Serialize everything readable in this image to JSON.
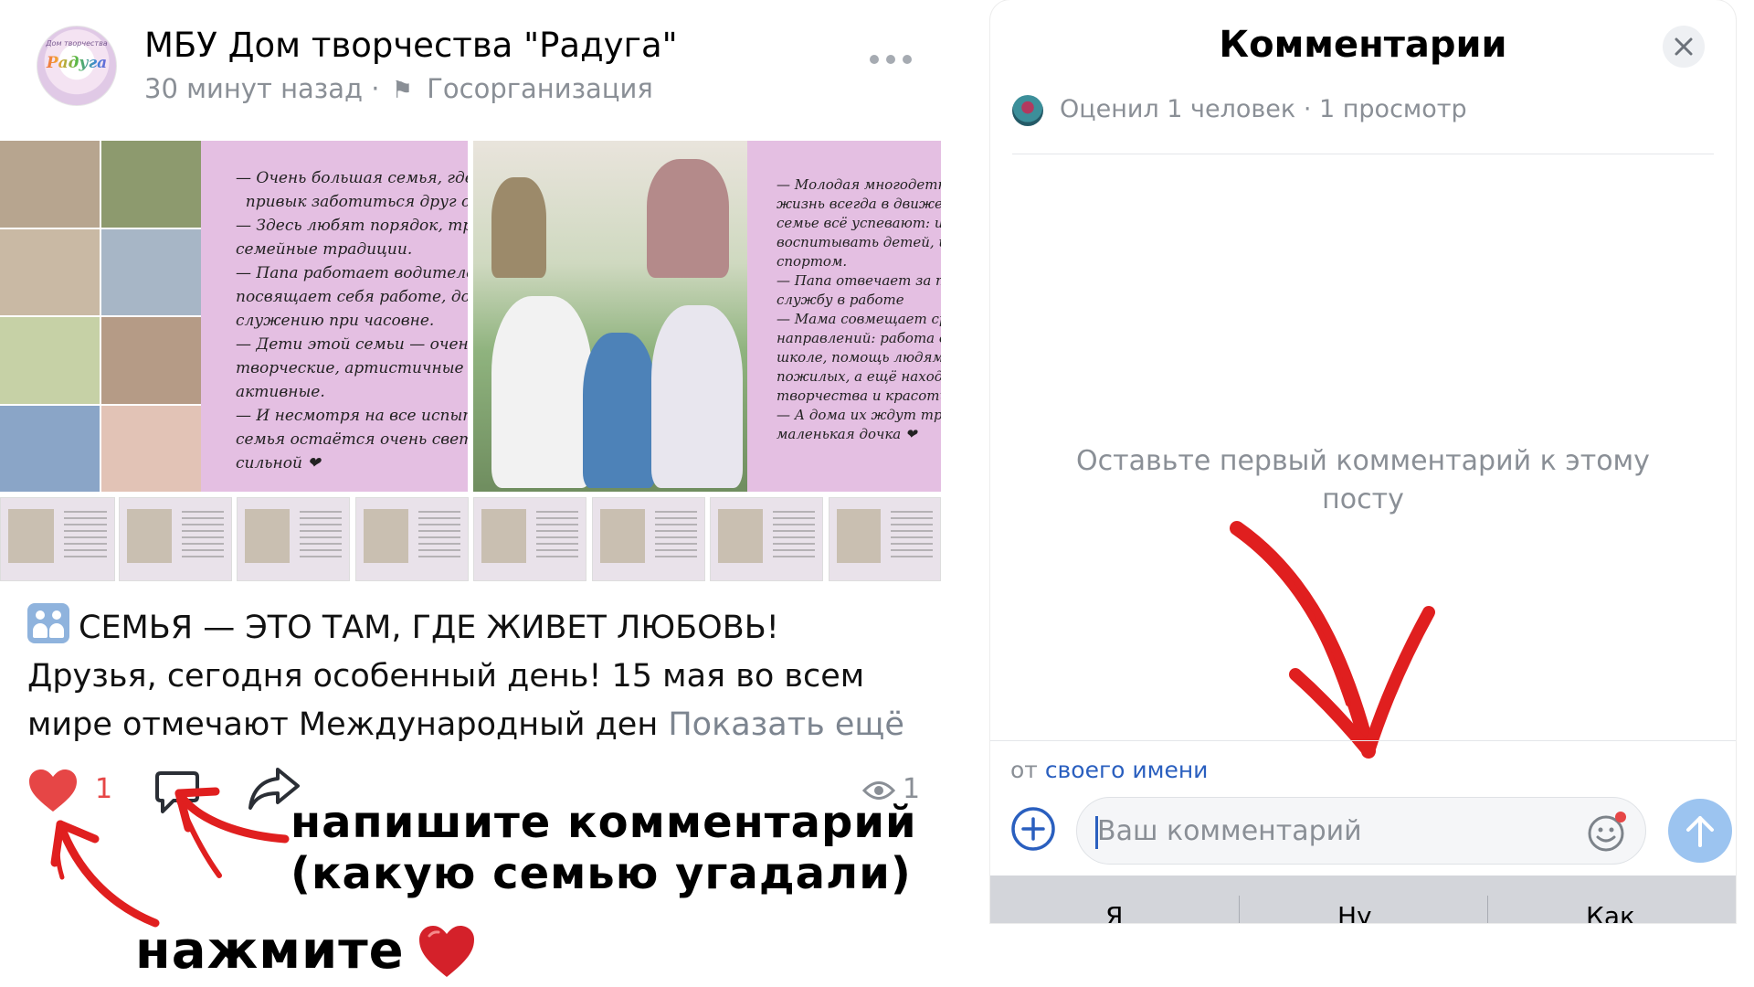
{
  "post": {
    "author": "МБУ Дом творчества \"Радуга\"",
    "time": "30 минут назад",
    "separator": "·",
    "org_type": "Госорганизация",
    "avatar_logo_top": "Дом творчества",
    "avatar_logo_word": "Радуга",
    "image1_text": "— Очень большая семья, где ка\n  привык заботиться друг о дру\n— Здесь любят порядок, труд\nсемейные традиции.\n— Папа работает водителем\nпосвящает себя работе, дому\nслужению при часовне.\n— Дети этой семьи — очень\nтворческие, артистичные и\nактивные.\n— И несмотря на все испытан\nсемья остаётся очень светлой\nсильной ❤",
    "image2_text": "— Молодая многодетная се\nжизнь всегда в движении. В\nсемье всё успевают: и рабо\nвоспитывать детей, и зан\nспортом.\n— Папа отвечает за техн\nслужбу в работе\n— Мама совмещает сразу\nнаправлений: работа с дет\nшколе, помощь людям и за\nпожилых, а ещё находит вр\nтворчества и красоты\n— А дома их ждут три сын\nмаленькая дочка ❤",
    "text_line1": "СЕМЬЯ — ЭТО ТАМ, ГДЕ ЖИВЕТ ЛЮБОВЬ!",
    "text_line2": "Друзья, сегодня особенный день! 15 мая во всем",
    "text_line3": "мире отмечают Международный ден",
    "show_more": "Показать ещё",
    "likes": "1",
    "views": "1"
  },
  "annotations": {
    "line1": "напишите комментарий",
    "line2": "(какую семью угадали)",
    "line3": "нажмите"
  },
  "comments": {
    "title": "Комментарии",
    "rated": "Оценил 1 человек",
    "views": "1 просмотр",
    "separator": "·",
    "empty": "Оставьте первый комментарий к этому посту",
    "from_prefix": "от",
    "from_link": "своего имени",
    "input_placeholder": "Ваш комментарий",
    "input_value": "",
    "keyboard_suggestions": [
      "Я",
      "Ну",
      "Как"
    ]
  },
  "colors": {
    "heart": "#e64646",
    "annotation_arrow": "#e01f1f",
    "link": "#2a5fbf",
    "muted": "#8a8f96",
    "send_button": "#9cc4f0",
    "photo_panel": "#e4bfe2"
  },
  "icons": {
    "more": "more-icon",
    "like": "heart-icon",
    "comment": "comment-icon",
    "share": "share-icon",
    "views": "eye-icon",
    "close": "close-icon",
    "add": "plus-circle-icon",
    "emoji": "emoji-icon",
    "send": "arrow-up-icon",
    "flag": "flag-icon",
    "family": "family-icon"
  }
}
